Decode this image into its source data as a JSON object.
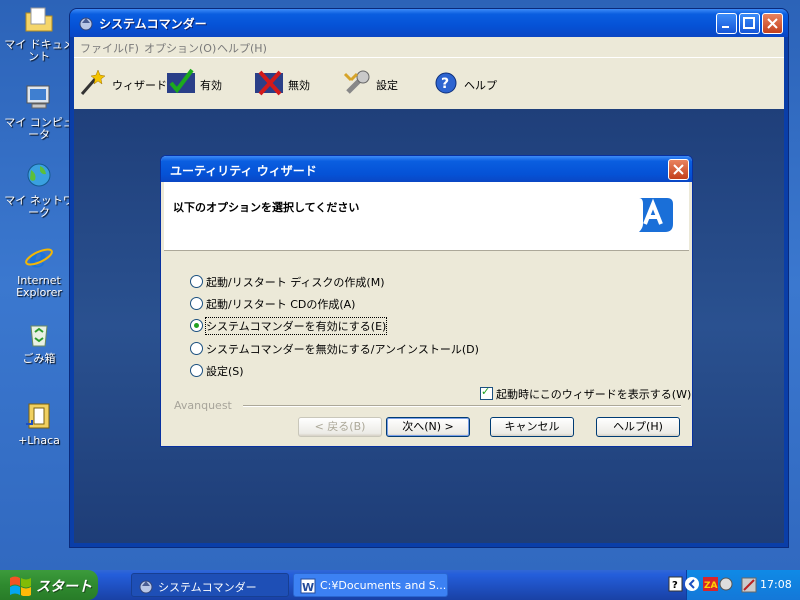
{
  "desktop": {
    "icons": [
      {
        "label": "マイ ドキュメント"
      },
      {
        "label": "マイ コンピュータ"
      },
      {
        "label": "マイ ネットワーク"
      },
      {
        "label": "Internet Explorer"
      },
      {
        "label": "ごみ箱"
      },
      {
        "label": "+Lhaca"
      }
    ]
  },
  "window": {
    "title": "システムコマンダー",
    "menu": [
      "ファイル(F)",
      "オプション(O)",
      "ヘルプ(H)"
    ],
    "toolbar": [
      {
        "label": "ウィザード",
        "icon": "wand-icon"
      },
      {
        "label": "有効",
        "icon": "enable-check-icon"
      },
      {
        "label": "無効",
        "icon": "disable-x-icon"
      },
      {
        "label": "設定",
        "icon": "wrench-icon"
      },
      {
        "label": "ヘルプ",
        "icon": "help-icon"
      }
    ]
  },
  "dialog": {
    "title": "ユーティリティ ウィザード",
    "heading": "以下のオプションを選択してください",
    "options": [
      {
        "label": "起動/リスタート ディスクの作成(M)",
        "selected": false
      },
      {
        "label": "起動/リスタート CDの作成(A)",
        "selected": false
      },
      {
        "label": "システムコマンダーを有効にする(E)",
        "selected": true
      },
      {
        "label": "システムコマンダーを無効にする/アンインストール(D)",
        "selected": false
      },
      {
        "label": "設定(S)",
        "selected": false
      }
    ],
    "show_wizard_checkbox": {
      "label": "起動時にこのウィザードを表示する(W)",
      "checked": true
    },
    "brand": "Avanquest",
    "buttons": {
      "back": "< 戻る(B)",
      "next": "次へ(N) >",
      "cancel": "キャンセル",
      "help": "ヘルプ(H)"
    }
  },
  "taskbar": {
    "start": "スタート",
    "tasks": [
      {
        "label": "システムコマンダー"
      },
      {
        "label": "C:¥Documents and S..."
      }
    ],
    "clock": "17:08"
  },
  "colors": {
    "xp_title_blue": "#0552d6",
    "dialog_face": "#ece9d8",
    "start_green": "#2f8a2f"
  }
}
